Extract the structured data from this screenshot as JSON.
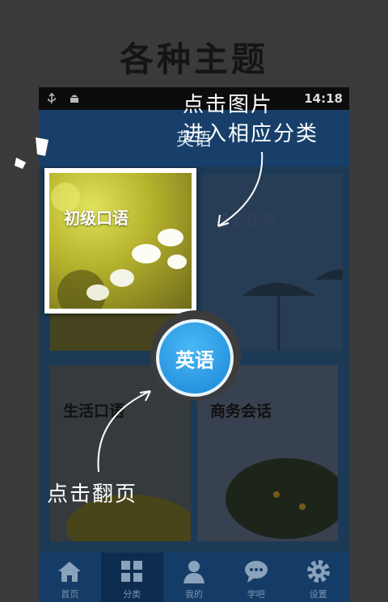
{
  "page": {
    "title": "各种主题"
  },
  "status_bar": {
    "time": "14:18"
  },
  "app_header": {
    "title": "英语"
  },
  "tiles": [
    {
      "label": "初级口语"
    },
    {
      "label": "名言佳句"
    },
    {
      "label": "生活口语"
    },
    {
      "label": "商务会话"
    }
  ],
  "center_button": {
    "label": "英语",
    "color": "#2196e8"
  },
  "hints": {
    "top_line1": "点击图片",
    "top_line2": "进入相应分类",
    "bottom": "点击翻页"
  },
  "tab_bar": {
    "tabs": [
      {
        "label": "首页",
        "icon": "home-icon"
      },
      {
        "label": "分类",
        "icon": "grid-icon"
      },
      {
        "label": "我的",
        "icon": "person-icon"
      },
      {
        "label": "学吧",
        "icon": "chat-bubble-icon"
      },
      {
        "label": "设置",
        "icon": "gear-icon"
      }
    ],
    "active_index": 1
  }
}
